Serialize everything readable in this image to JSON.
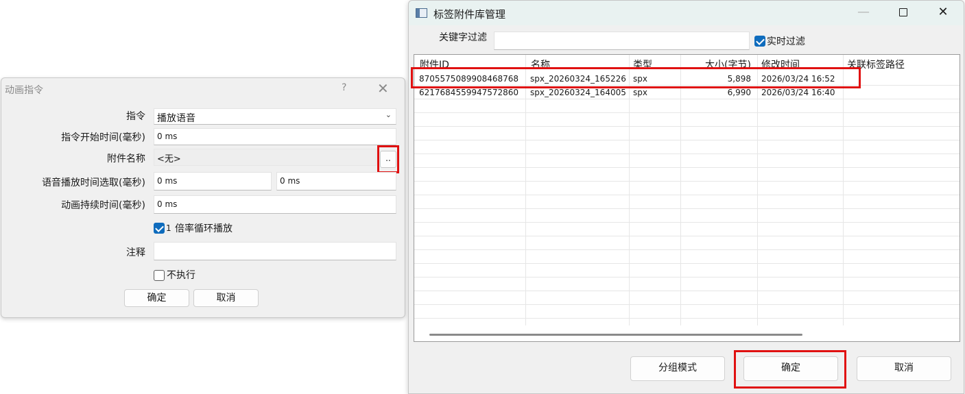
{
  "dialog1": {
    "title": "动画指令",
    "help": "?",
    "close": "✕",
    "fields": {
      "command_label": "指令",
      "command_value": "播放语音",
      "start_label": "指令开始时间(毫秒)",
      "start_value": "0 ms",
      "attach_label": "附件名称",
      "attach_value": "<无>",
      "browse_label": "..",
      "voice_label": "语音播放时间选取(毫秒)",
      "voice_start": "0 ms",
      "voice_end": "0 ms",
      "duration_label": "动画持续时间(毫秒)",
      "duration_value": "0 ms",
      "loop_label": "倍率循环播放",
      "loop_count": "1",
      "comment_label": "注释",
      "comment_value": "",
      "skip_label": "不执行"
    },
    "ok": "确定",
    "cancel": "取消"
  },
  "dialog2": {
    "title": "标签附件库管理",
    "min": "—",
    "close": "✕",
    "keyword_label": "关键字过滤",
    "keyword_value": "",
    "realtime_label": "实时过滤",
    "columns": [
      "附件ID",
      "名称",
      "类型",
      "大小(字节)",
      "修改时间",
      "关联标签路径"
    ],
    "rows": [
      {
        "id": "8705575089908468768",
        "name": "spx_20260324_165226",
        "type": "spx",
        "size": "5,898",
        "mtime": "2026/03/24 16:52",
        "path": ""
      },
      {
        "id": "6217684559947572860",
        "name": "spx_20260324_164005",
        "type": "spx",
        "size": "6,990",
        "mtime": "2026/03/24 16:40",
        "path": ""
      }
    ],
    "group_mode": "分组模式",
    "ok": "确定",
    "cancel": "取消"
  },
  "colors": {
    "accent": "#0f6cbd",
    "highlight": "#e01010"
  }
}
